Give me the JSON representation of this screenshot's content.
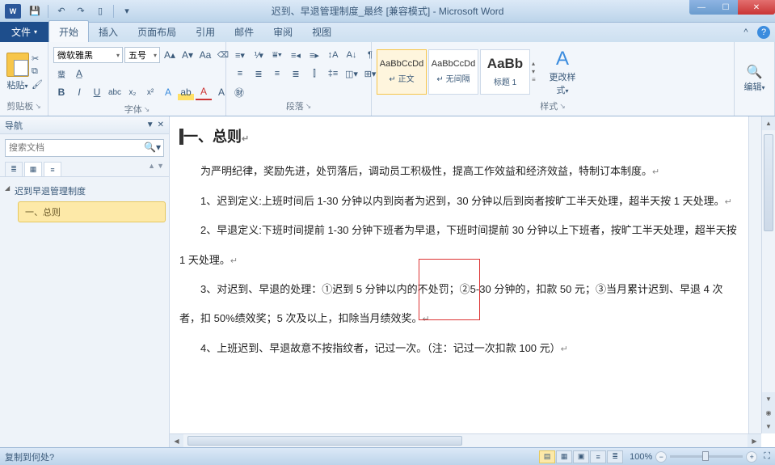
{
  "titlebar": {
    "app_icon_text": "W",
    "title": "迟到、早退管理制度_最终 [兼容模式] - Microsoft Word"
  },
  "tabs": {
    "file": "文件",
    "items": [
      "开始",
      "插入",
      "页面布局",
      "引用",
      "邮件",
      "审阅",
      "视图"
    ],
    "active_index": 0
  },
  "ribbon": {
    "clipboard": {
      "label": "剪贴板",
      "paste": "粘贴"
    },
    "font": {
      "label": "字体",
      "name": "微软雅黑",
      "size": "五号",
      "buttons": [
        "B",
        "I",
        "U",
        "abc",
        "x₂",
        "x²"
      ]
    },
    "paragraph": {
      "label": "段落"
    },
    "styles": {
      "label": "样式",
      "items": [
        {
          "preview": "AaBbCcDd",
          "name": "↵ 正文"
        },
        {
          "preview": "AaBbCcDd",
          "name": "↵ 无间隔"
        },
        {
          "preview": "AaBb",
          "name": "标题 1"
        }
      ],
      "change": "更改样式"
    },
    "edit": {
      "label": "编辑"
    }
  },
  "nav": {
    "title": "导航",
    "search_placeholder": "搜索文档",
    "tree_root": "迟到早退管理制度",
    "tree_child": "一、总则"
  },
  "document": {
    "heading": "一、总则",
    "p1": "为严明纪律，奖励先进，处罚落后，调动员工积极性，提高工作效益和经济效益，特制订本制度。",
    "p2": "1、迟到定义:上班时间后 1-30 分钟以内到岗者为迟到，30 分钟以后到岗者按旷工半天处理，超半天按 1 天处理。",
    "p3": "2、早退定义:下班时间提前 1-30 分钟下班者为早退，下班时间提前 30 分钟以上下班者，按旷工半天处理，超半天按 1 天处理。",
    "p4": "3、对迟到、早退的处理：①迟到 5 分钟以内的不处罚；②5-30 分钟的，扣款 50 元；③当月累计迟到、早退 4 次者，扣 50%绩效奖；5 次及以上，扣除当月绩效奖。",
    "p5": "4、上班迟到、早退故意不按指纹者，记过一次。（注：记过一次扣款 100 元）"
  },
  "statusbar": {
    "left": "复制到何处?",
    "zoom": "100%"
  }
}
